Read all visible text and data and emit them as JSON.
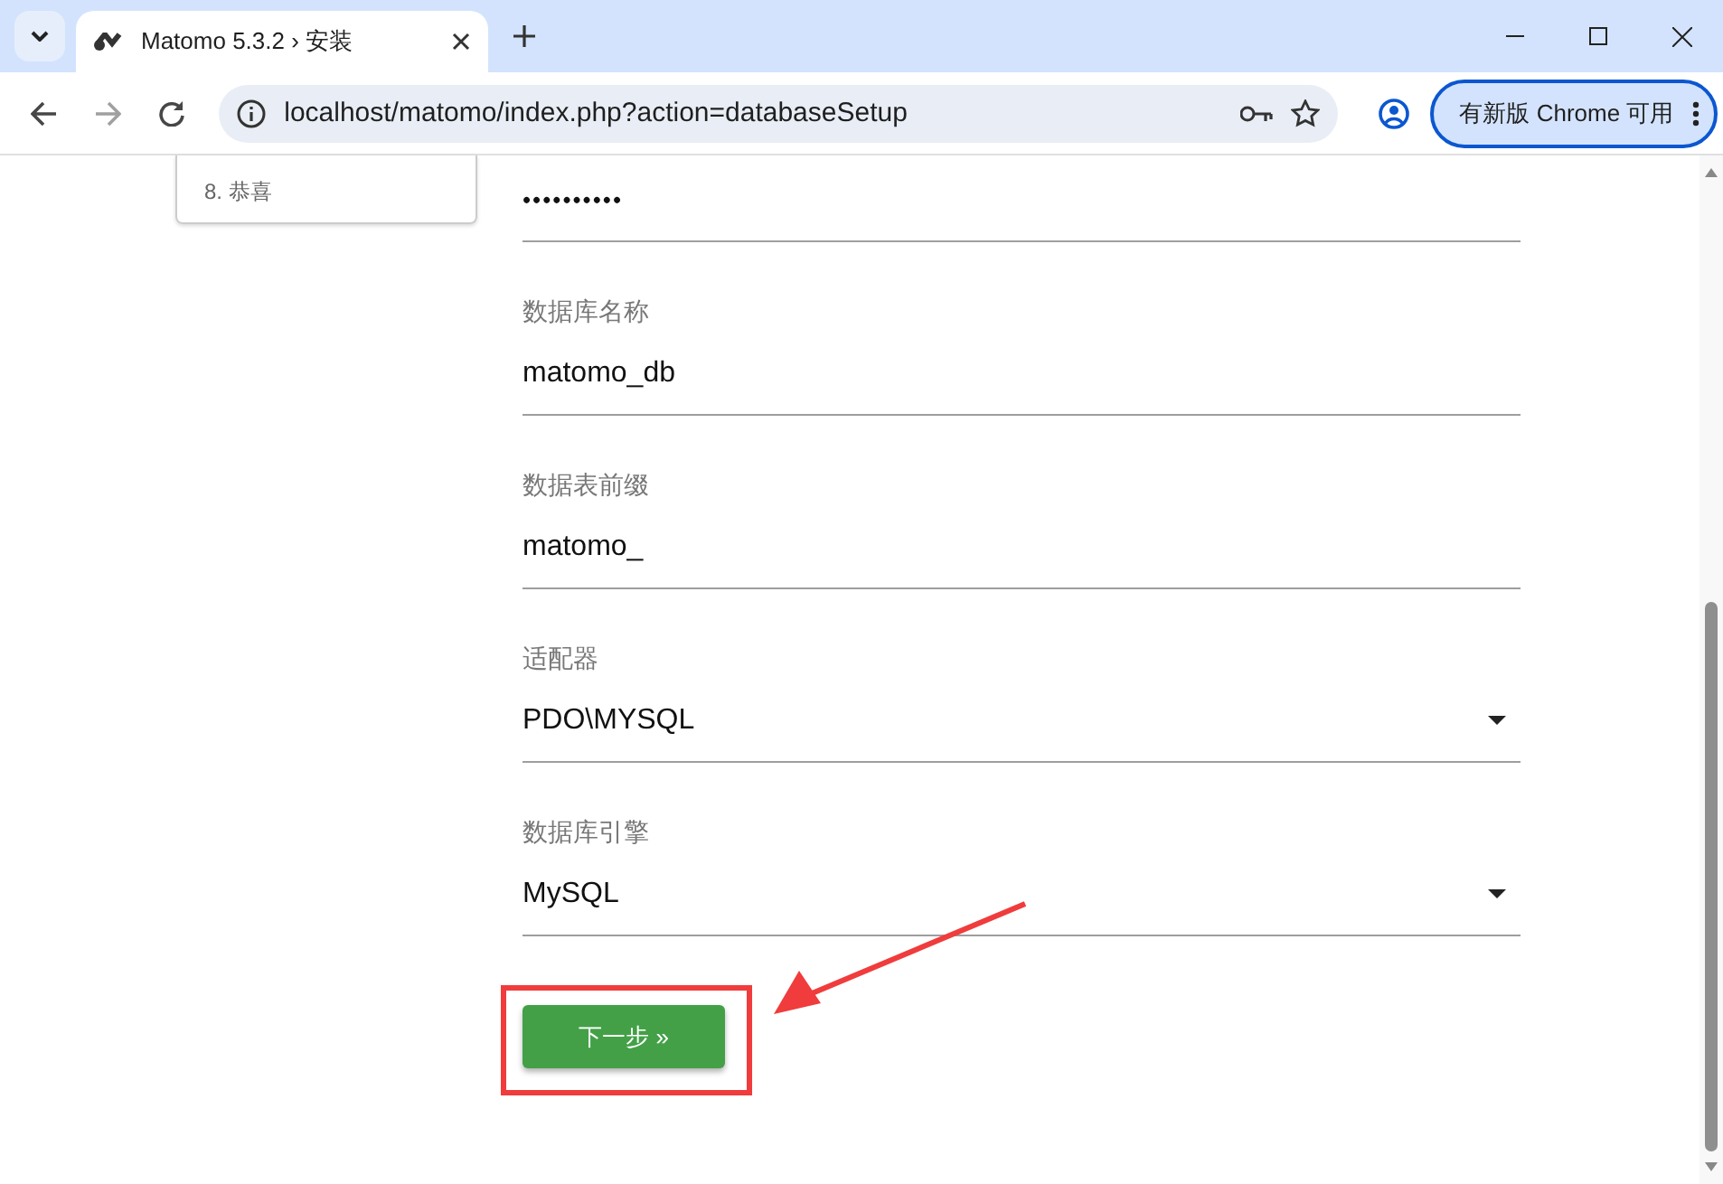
{
  "browser": {
    "tab": {
      "title": "Matomo 5.3.2 › 安装"
    },
    "address": "localhost/matomo/index.php?action=databaseSetup",
    "update_button": "有新版 Chrome 可用"
  },
  "sidebar": {
    "items": [
      {
        "label": "8. 恭喜"
      }
    ]
  },
  "fields": [
    {
      "kind": "password",
      "value": "••••••••••"
    },
    {
      "kind": "text",
      "label": "数据库名称",
      "value": "matomo_db"
    },
    {
      "kind": "text",
      "label": "数据表前缀",
      "value": "matomo_"
    },
    {
      "kind": "select",
      "label": "适配器",
      "value": "PDO\\MYSQL"
    },
    {
      "kind": "select",
      "label": "数据库引擎",
      "value": "MySQL"
    }
  ],
  "next_button": "下一步 »"
}
